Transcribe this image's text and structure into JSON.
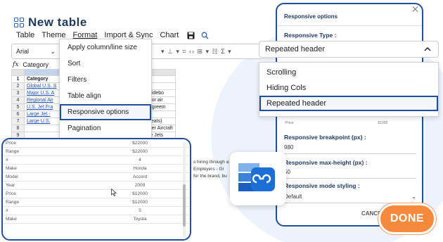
{
  "app": {
    "title": "New table"
  },
  "menubar": [
    "Table",
    "Theme",
    "Format",
    "Import & Sync",
    "Chart"
  ],
  "toolbar": {
    "font": "Arial"
  },
  "formula": {
    "label": "fx",
    "value": "Category"
  },
  "sheet": {
    "headers": {
      "row": "1",
      "category": "Category",
      "description": "Description test"
    },
    "rows": [
      {
        "n": "2",
        "category": "Global U.S. S",
        "description": "Flying 100 or more widebody aircraft"
      },
      {
        "n": "3",
        "category": "Major U.S. A",
        "description": "Flying 100+ aircraft w 100 seats or 50 widebo"
      },
      {
        "n": "4",
        "category": "Regional Air",
        "description": "Flying small jets and feeding Global/Major air"
      },
      {
        "n": "5",
        "category": "U.S. Jet Fra",
        "description": "Flying Business Jets Under Fractional Agreem"
      },
      {
        "n": "6",
        "category": "Large Jet -",
        "description": "Flying Cargo Only in Large Jets"
      },
      {
        "n": "7",
        "category": "Large U.S.",
        "description": "Flying Less Than 100 Large Jets (100 seats)"
      },
      {
        "n": "8",
        "category": "",
        "description": "Flying Scheduled Passengers in Propeller Aircraft"
      },
      {
        "n": "9",
        "category": "",
        "description": "Flying Jet Charters (and Cargo) in Large Jets"
      }
    ]
  },
  "format_menu": {
    "items": [
      "Apply column/line size",
      "Sort",
      "Filters",
      "Table align",
      "Responsive options",
      "Pagination"
    ],
    "selected": "Responsive options"
  },
  "mobile_preview": {
    "rows": [
      {
        "k": "Price",
        "v": "$22000"
      },
      {
        "k": "Range",
        "v": "$22000"
      },
      {
        "k": "#",
        "v": "4"
      },
      {
        "k": "Make",
        "v": "Honda"
      },
      {
        "k": "Model",
        "v": "Accord"
      },
      {
        "k": "Year",
        "v": "2009"
      },
      {
        "k": "Price",
        "v": "$12000"
      },
      {
        "k": "Range",
        "v": "$12000"
      },
      {
        "k": "#",
        "v": "5"
      },
      {
        "k": "Make",
        "v": "Toyota"
      }
    ]
  },
  "peek_text": [
    "s hiring through a",
    "Employers - Gr",
    "for the brand, bu"
  ],
  "responsive_panel": {
    "title": "Responsive options",
    "type_label": "Responsive Type :",
    "type_value": "Repeated header",
    "type_options": [
      "Scrolling",
      "Hiding Cols",
      "Repeated header"
    ],
    "thumb_left": "Price",
    "thumb_right": "$1000",
    "breakpoint_label": "Responsive breakpoint (px) :",
    "breakpoint_value": "980",
    "maxheight_label": "Responsive max-height (px) :",
    "maxheight_value": "50",
    "styling_label": "Responsive mode styling :",
    "styling_value": "Default",
    "cancel": "CANCEL",
    "done": "DONE"
  },
  "colors": {
    "accent": "#1f4f9e",
    "done": "#f58a3d",
    "link": "#1a4fbf"
  }
}
